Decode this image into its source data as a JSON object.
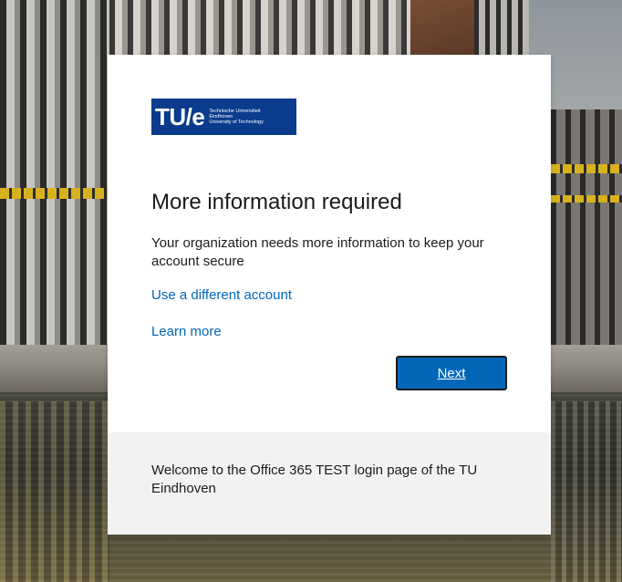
{
  "logo": {
    "mark": "TU/e",
    "line1": "Technische Universiteit",
    "line2": "Eindhoven",
    "line3": "University of Technology",
    "background_color": "#0a3b8c"
  },
  "heading": "More information required",
  "description": "Your organization needs more information to keep your account secure",
  "links": {
    "different_account": "Use a different account",
    "learn_more": "Learn more"
  },
  "buttons": {
    "next": "Next"
  },
  "footer": {
    "text": "Welcome to the Office 365 TEST login page of the TU Eindhoven"
  },
  "colors": {
    "accent": "#0067b8",
    "footer_bg": "#f2f2f2"
  }
}
